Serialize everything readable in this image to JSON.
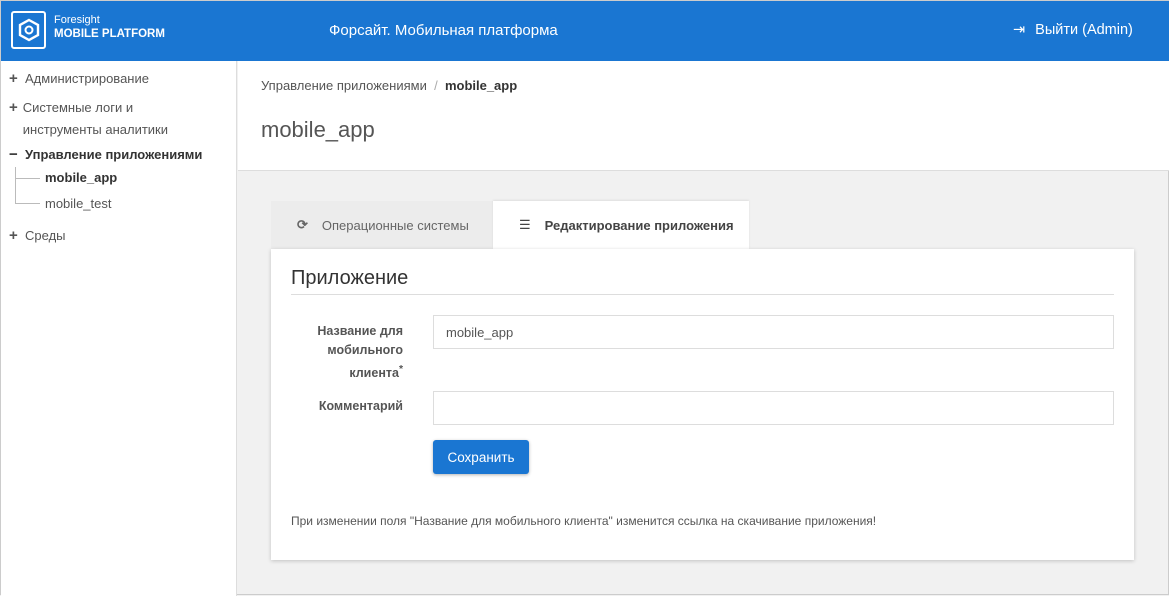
{
  "header": {
    "logo_line1": "Foresight",
    "logo_line2": "MOBILE PLATFORM",
    "title": "Форсайт. Мобильная платформа",
    "logout": "Выйти (Admin)"
  },
  "sidebar": {
    "items": [
      {
        "label": "Администрирование"
      },
      {
        "label": "Системные логи и инструменты аналитики"
      },
      {
        "label": "Управление приложениями"
      },
      {
        "label": "Среды"
      }
    ],
    "apps": [
      "mobile_app",
      "mobile_test"
    ]
  },
  "breadcrumb": {
    "parent": "Управление приложениями",
    "sep": "/",
    "current": "mobile_app"
  },
  "page_title": "mobile_app",
  "tabs": [
    "Операционные системы",
    "Редактирование приложения"
  ],
  "form": {
    "section": "Приложение",
    "name_label": "Название для мобильного клиента",
    "required": "*",
    "name_value": "mobile_app",
    "comment_label": "Комментарий",
    "comment_value": "",
    "save": "Сохранить",
    "note": "При изменении поля \"Название для мобильного клиента\" изменится ссылка на скачивание приложения!"
  }
}
